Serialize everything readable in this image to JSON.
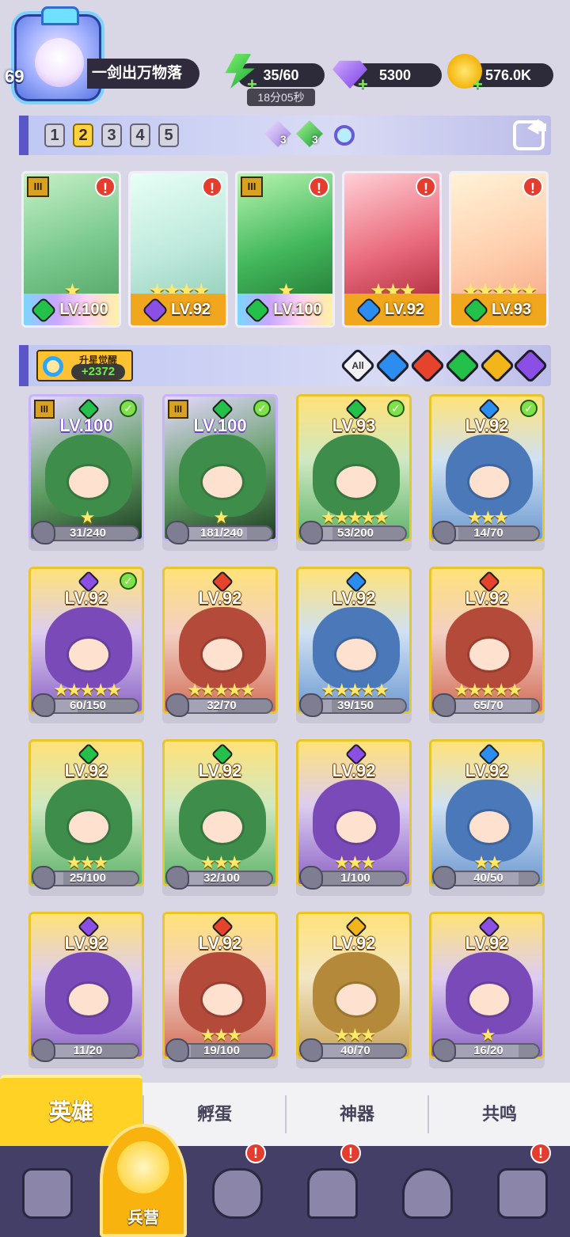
{
  "player": {
    "level": "69",
    "name": "一剑出万物落"
  },
  "resources": {
    "energy": "35/60",
    "energy_timer": "18分05秒",
    "gems": "5300",
    "gold": "576.0K"
  },
  "teams": {
    "tabs": [
      "1",
      "2",
      "3",
      "4",
      "5"
    ],
    "active_tab": "2",
    "purple_crystal_count": "3",
    "green_crystal_count": "3"
  },
  "team_heroes": [
    {
      "level": "LV.100",
      "stars": "★",
      "element": "green",
      "rank": "III",
      "bg": "rainbow"
    },
    {
      "level": "LV.92",
      "stars": "★★★★",
      "element": "purple",
      "rank": "",
      "bg": "gold"
    },
    {
      "level": "LV.100",
      "stars": "★",
      "element": "green",
      "rank": "III",
      "bg": "rainbow"
    },
    {
      "level": "LV.92",
      "stars": "★★★",
      "element": "blue",
      "rank": "",
      "bg": "gold"
    },
    {
      "level": "LV.93",
      "stars": "★★★★★",
      "element": "green",
      "rank": "",
      "bg": "gold"
    }
  ],
  "filters": {
    "awaken_title": "升星觉醒",
    "awaken_value": "+2372",
    "all_label": "All",
    "elements": [
      "blue",
      "red",
      "green",
      "yellow",
      "purple"
    ]
  },
  "heroes": [
    {
      "level": "LV.100",
      "element": "green",
      "stars": "★",
      "fragments": "31/240",
      "progress": 0.13,
      "checked": true,
      "rank": "III",
      "style": "rainbow"
    },
    {
      "level": "LV.100",
      "element": "green",
      "stars": "★",
      "fragments": "181/240",
      "progress": 0.75,
      "checked": true,
      "rank": "III",
      "style": "rainbow"
    },
    {
      "level": "LV.93",
      "element": "green",
      "stars": "★★★★★",
      "fragments": "53/200",
      "progress": 0.27,
      "checked": true,
      "rank": "",
      "style": "gold"
    },
    {
      "level": "LV.92",
      "element": "blue",
      "stars": "★★★",
      "fragments": "14/70",
      "progress": 0.2,
      "checked": true,
      "rank": "",
      "style": "gold"
    },
    {
      "level": "LV.92",
      "element": "purple",
      "stars": "★★★★★",
      "fragments": "60/150",
      "progress": 0.4,
      "checked": true,
      "rank": "",
      "style": "gold"
    },
    {
      "level": "LV.92",
      "element": "red",
      "stars": "★★★★★",
      "fragments": "32/70",
      "progress": 0.46,
      "checked": false,
      "rank": "",
      "style": "gold"
    },
    {
      "level": "LV.92",
      "element": "blue",
      "stars": "★★★★★",
      "fragments": "39/150",
      "progress": 0.26,
      "checked": false,
      "rank": "",
      "style": "gold"
    },
    {
      "level": "LV.92",
      "element": "red",
      "stars": "★★★★★",
      "fragments": "65/70",
      "progress": 0.93,
      "checked": false,
      "rank": "",
      "style": "gold"
    },
    {
      "level": "LV.92",
      "element": "green",
      "stars": "★★★",
      "fragments": "25/100",
      "progress": 0.25,
      "checked": false,
      "rank": "",
      "style": "gold"
    },
    {
      "level": "LV.92",
      "element": "green",
      "stars": "★★★",
      "fragments": "32/100",
      "progress": 0.32,
      "checked": false,
      "rank": "",
      "style": "gold"
    },
    {
      "level": "LV.92",
      "element": "purple",
      "stars": "★★★",
      "fragments": "1/100",
      "progress": 0.01,
      "checked": false,
      "rank": "",
      "style": "gold"
    },
    {
      "level": "LV.92",
      "element": "blue",
      "stars": "★★",
      "fragments": "40/50",
      "progress": 0.8,
      "checked": false,
      "rank": "",
      "style": "gold"
    },
    {
      "level": "LV.92",
      "element": "purple",
      "stars": "",
      "fragments": "11/20",
      "progress": 0.55,
      "checked": false,
      "rank": "",
      "style": "gold"
    },
    {
      "level": "LV.92",
      "element": "red",
      "stars": "★★★",
      "fragments": "19/100",
      "progress": 0.19,
      "checked": false,
      "rank": "",
      "style": "gold"
    },
    {
      "level": "LV.92",
      "element": "yellow",
      "stars": "★★★",
      "fragments": "40/70",
      "progress": 0.57,
      "checked": false,
      "rank": "",
      "style": "gold"
    },
    {
      "level": "LV.92",
      "element": "purple",
      "stars": "★",
      "fragments": "16/20",
      "progress": 0.8,
      "checked": false,
      "rank": "",
      "style": "gold"
    }
  ],
  "subtabs": [
    "英雄",
    "孵蛋",
    "神器",
    "共鸣"
  ],
  "nav": {
    "center_label": "兵营",
    "alert": "!"
  },
  "colors": {
    "green": "#23c04a",
    "purple": "#8b4fe6",
    "blue": "#2b8df0",
    "red": "#e5432b",
    "yellow": "#f2b51a"
  }
}
